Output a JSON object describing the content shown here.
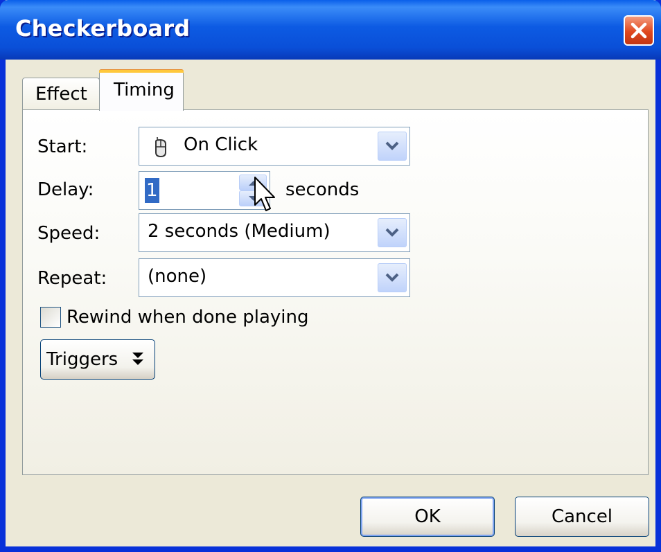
{
  "window": {
    "title": "Checkerboard"
  },
  "tabs": [
    {
      "label": "Effect",
      "selected": false
    },
    {
      "label": "Timing",
      "selected": true
    }
  ],
  "timing": {
    "start": {
      "label": "Start:",
      "value": "On Click",
      "icon": "mouse-icon"
    },
    "delay": {
      "label": "Delay:",
      "value": "1",
      "unit": "seconds"
    },
    "speed": {
      "label": "Speed:",
      "value": "2 seconds (Medium)"
    },
    "repeat": {
      "label": "Repeat:",
      "value": "(none)"
    },
    "rewind": {
      "label": "Rewind when done playing",
      "checked": false
    },
    "triggers": {
      "label": "Triggers"
    }
  },
  "buttons": {
    "ok": "OK",
    "cancel": "Cancel"
  },
  "colors": {
    "titlebar": "#0A4FD8",
    "selection": "#316AC5",
    "tab_highlight": "#FFC83C"
  }
}
